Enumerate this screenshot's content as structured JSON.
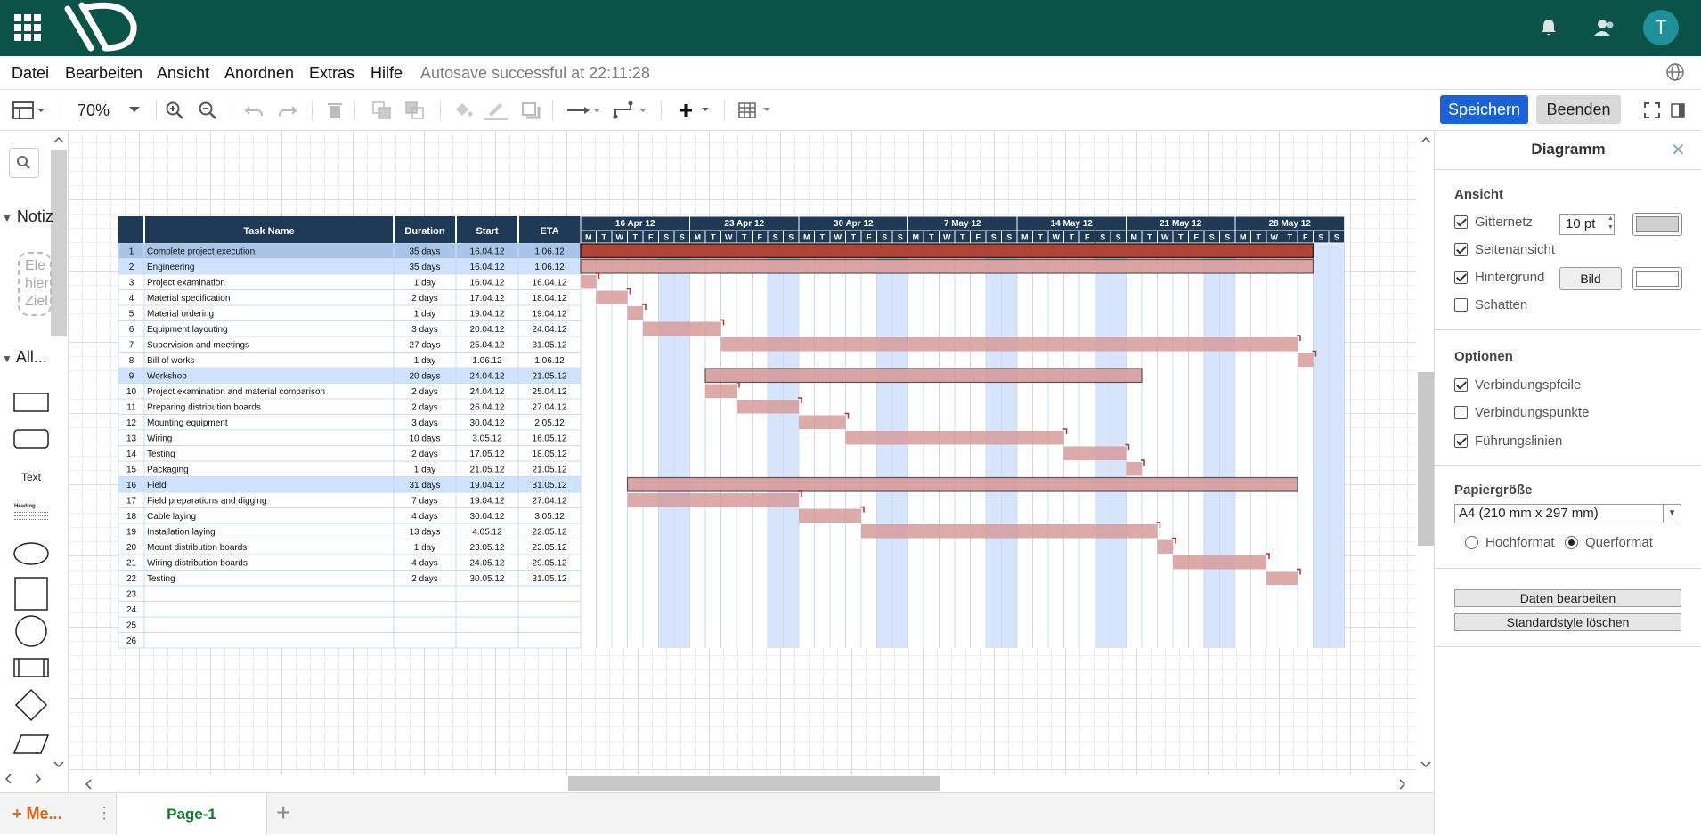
{
  "topbar": {
    "avatar_letter": "T",
    "bg": "#0b5348"
  },
  "menu": {
    "items": [
      "Datei",
      "Bearbeiten",
      "Ansicht",
      "Anordnen",
      "Extras",
      "Hilfe"
    ],
    "autosave": "Autosave successful at 22:11:28"
  },
  "toolbar": {
    "zoom": "70%",
    "save": "Speichern",
    "end": "Beenden"
  },
  "left_panel": {
    "notes_label": "Notiz",
    "notes_text": "Ele hier Ziel",
    "all_label": "All...",
    "text_shape": "Text",
    "heading_shape": "Heading"
  },
  "tabs": {
    "more": "+ Me...",
    "page": "Page-1"
  },
  "right_panel": {
    "title": "Diagramm",
    "view_section": "Ansicht",
    "grid": {
      "label": "Gitternetz",
      "checked": true,
      "size": "10 pt"
    },
    "page_view": {
      "label": "Seitenansicht",
      "checked": true
    },
    "background": {
      "label": "Hintergrund",
      "checked": true,
      "image_button": "Bild"
    },
    "shadow": {
      "label": "Schatten",
      "checked": false
    },
    "options_section": "Optionen",
    "connection_arrows": {
      "label": "Verbindungspfeile",
      "checked": true
    },
    "connection_points": {
      "label": "Verbindungspunkte",
      "checked": false
    },
    "guides": {
      "label": "Führungslinien",
      "checked": true
    },
    "paper_section": "Papiergröße",
    "paper_size": "A4 (210 mm x 297 mm)",
    "portrait": {
      "label": "Hochformat",
      "checked": false
    },
    "landscape": {
      "label": "Querformat",
      "checked": true
    },
    "edit_data": "Daten bearbeiten",
    "clear_style": "Standardstyle löschen"
  },
  "gantt": {
    "headers": [
      "Task Name",
      "Duration",
      "Start",
      "ETA"
    ],
    "weeks": [
      "16 Apr 12",
      "23 Apr 12",
      "30 Apr 12",
      "7 May 12",
      "14 May 12",
      "21 May 12",
      "28 May 12"
    ],
    "day_letters": [
      "M",
      "T",
      "W",
      "T",
      "F",
      "S",
      "S"
    ],
    "start_date": "16.04.12",
    "rows": [
      {
        "n": "1",
        "name": "Complete project execution",
        "duration": "35 days",
        "start": "16.04.12",
        "eta": "1.06.12"
      },
      {
        "n": "2",
        "name": "Engineering",
        "duration": "35 days",
        "start": "16.04.12",
        "eta": "1.06.12"
      },
      {
        "n": "3",
        "name": "Project examination",
        "duration": "1 day",
        "start": "16.04.12",
        "eta": "16.04.12"
      },
      {
        "n": "4",
        "name": "Material specification",
        "duration": "2 days",
        "start": "17.04.12",
        "eta": "18.04.12"
      },
      {
        "n": "5",
        "name": "Material ordering",
        "duration": "1 day",
        "start": "19.04.12",
        "eta": "19.04.12"
      },
      {
        "n": "6",
        "name": "Equipment layouting",
        "duration": "3 days",
        "start": "20.04.12",
        "eta": "24.04.12"
      },
      {
        "n": "7",
        "name": "Supervision and meetings",
        "duration": "27 days",
        "start": "25.04.12",
        "eta": "31.05.12"
      },
      {
        "n": "8",
        "name": "Bill of works",
        "duration": "1 day",
        "start": "1.06.12",
        "eta": "1.06.12"
      },
      {
        "n": "9",
        "name": "Workshop",
        "duration": "20 days",
        "start": "24.04.12",
        "eta": "21.05.12"
      },
      {
        "n": "10",
        "name": "Project examination and material comparison",
        "duration": "2 days",
        "start": "24.04.12",
        "eta": "25.04.12"
      },
      {
        "n": "11",
        "name": "Preparing distribution boards",
        "duration": "2 days",
        "start": "26.04.12",
        "eta": "27.04.12"
      },
      {
        "n": "12",
        "name": "Mounting equipment",
        "duration": "3 days",
        "start": "30.04.12",
        "eta": "2.05.12"
      },
      {
        "n": "13",
        "name": "Wiring",
        "duration": "10 days",
        "start": "3.05.12",
        "eta": "16.05.12"
      },
      {
        "n": "14",
        "name": "Testing",
        "duration": "2 days",
        "start": "17.05.12",
        "eta": "18.05.12"
      },
      {
        "n": "15",
        "name": "Packaging",
        "duration": "1 day",
        "start": "21.05.12",
        "eta": "21.05.12"
      },
      {
        "n": "16",
        "name": "Field",
        "duration": "31 days",
        "start": "19.04.12",
        "eta": "31.05.12"
      },
      {
        "n": "17",
        "name": "Field preparations and digging",
        "duration": "7 days",
        "start": "19.04.12",
        "eta": "27.04.12"
      },
      {
        "n": "18",
        "name": "Cable laying",
        "duration": "4 days",
        "start": "30.04.12",
        "eta": "3.05.12"
      },
      {
        "n": "19",
        "name": "Installation laying",
        "duration": "13 days",
        "start": "4.05.12",
        "eta": "22.05.12"
      },
      {
        "n": "20",
        "name": "Mount distribution boards",
        "duration": "1 day",
        "start": "23.05.12",
        "eta": "23.05.12"
      },
      {
        "n": "21",
        "name": "Wiring distribution boards",
        "duration": "4 days",
        "start": "24.05.12",
        "eta": "29.05.12"
      },
      {
        "n": "22",
        "name": "Testing",
        "duration": "2 days",
        "start": "30.05.12",
        "eta": "31.05.12"
      },
      {
        "n": "23",
        "name": "",
        "duration": "",
        "start": "",
        "eta": ""
      },
      {
        "n": "24",
        "name": "",
        "duration": "",
        "start": "",
        "eta": ""
      },
      {
        "n": "25",
        "name": "",
        "duration": "",
        "start": "",
        "eta": ""
      },
      {
        "n": "26",
        "name": "",
        "duration": "",
        "start": "",
        "eta": ""
      }
    ],
    "bars": [
      {
        "row": 1,
        "from": 0,
        "days": 47,
        "kind": "summary-dark"
      },
      {
        "row": 2,
        "from": 0,
        "days": 47,
        "kind": "summary"
      },
      {
        "row": 3,
        "from": 0,
        "days": 1,
        "kind": "task"
      },
      {
        "row": 4,
        "from": 1,
        "days": 2,
        "kind": "task"
      },
      {
        "row": 5,
        "from": 3,
        "days": 1,
        "kind": "task"
      },
      {
        "row": 6,
        "from": 4,
        "days": 5,
        "kind": "task"
      },
      {
        "row": 7,
        "from": 9,
        "days": 37,
        "kind": "task"
      },
      {
        "row": 8,
        "from": 46,
        "days": 1,
        "kind": "task"
      },
      {
        "row": 9,
        "from": 8,
        "days": 28,
        "kind": "summary"
      },
      {
        "row": 10,
        "from": 8,
        "days": 2,
        "kind": "task"
      },
      {
        "row": 11,
        "from": 10,
        "days": 4,
        "kind": "task"
      },
      {
        "row": 12,
        "from": 14,
        "days": 3,
        "kind": "task"
      },
      {
        "row": 13,
        "from": 17,
        "days": 14,
        "kind": "task"
      },
      {
        "row": 14,
        "from": 31,
        "days": 4,
        "kind": "task"
      },
      {
        "row": 15,
        "from": 35,
        "days": 1,
        "kind": "task"
      },
      {
        "row": 16,
        "from": 3,
        "days": 43,
        "kind": "summary"
      },
      {
        "row": 17,
        "from": 3,
        "days": 11,
        "kind": "task"
      },
      {
        "row": 18,
        "from": 14,
        "days": 4,
        "kind": "task"
      },
      {
        "row": 19,
        "from": 18,
        "days": 19,
        "kind": "task"
      },
      {
        "row": 20,
        "from": 37,
        "days": 1,
        "kind": "task"
      },
      {
        "row": 21,
        "from": 38,
        "days": 6,
        "kind": "task"
      },
      {
        "row": 22,
        "from": 44,
        "days": 2,
        "kind": "task"
      }
    ],
    "highlight_rows": [
      1,
      2,
      9,
      16
    ],
    "colors": {
      "header": "#1e3a56",
      "row_highlight": "#cfe2ff",
      "bar": "#d79b9b",
      "bar_dark": "#b04335",
      "weekend": "#d8e4fb"
    }
  }
}
